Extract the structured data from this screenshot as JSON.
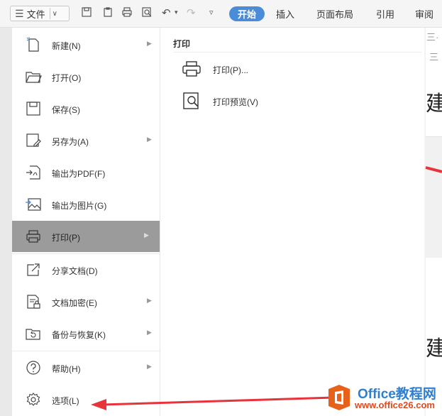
{
  "toolbar": {
    "file_label": "文件",
    "tabs": [
      {
        "label": "开始",
        "active": true
      },
      {
        "label": "插入"
      },
      {
        "label": "页面布局"
      },
      {
        "label": "引用"
      },
      {
        "label": "审阅"
      }
    ],
    "quick_access_icons": [
      "save-icon",
      "clipboard-icon",
      "print-icon",
      "print-preview-icon",
      "undo-icon",
      "redo-icon",
      "customize-icon"
    ]
  },
  "file_menu": {
    "items": [
      {
        "label": "新建(N)",
        "icon": "new-doc-icon",
        "submenu": true
      },
      {
        "label": "打开(O)",
        "icon": "folder-open-icon",
        "submenu": false
      },
      {
        "label": "保存(S)",
        "icon": "save-icon",
        "submenu": false
      },
      {
        "label": "另存为(A)",
        "icon": "save-as-icon",
        "submenu": true
      },
      {
        "label": "输出为PDF(F)",
        "icon": "export-pdf-icon",
        "submenu": false
      },
      {
        "label": "输出为图片(G)",
        "icon": "export-image-icon",
        "submenu": false
      },
      {
        "label": "打印(P)",
        "icon": "print-icon",
        "submenu": true,
        "selected": true
      },
      {
        "label": "分享文档(D)",
        "icon": "share-icon",
        "submenu": false
      },
      {
        "label": "文档加密(E)",
        "icon": "encrypt-icon",
        "submenu": true
      },
      {
        "label": "备份与恢复(K)",
        "icon": "backup-icon",
        "submenu": true
      },
      {
        "label": "帮助(H)",
        "icon": "help-icon",
        "submenu": true
      },
      {
        "label": "选项(L)",
        "icon": "gear-icon",
        "submenu": false
      }
    ]
  },
  "print_submenu": {
    "title": "打印",
    "items": [
      {
        "label": "打印(P)...",
        "icon": "print-icon"
      },
      {
        "label": "打印预览(V)",
        "icon": "print-preview-icon"
      }
    ]
  },
  "document": {
    "visible_chars": [
      "建",
      "建"
    ]
  },
  "watermark": {
    "title": "Office教程网",
    "url": "www.office26.com"
  },
  "colors": {
    "accent": "#4b8cd9",
    "selected_item": "#9b9b9b",
    "annotation_arrow": "#e8333a",
    "watermark_blue": "#2f7fd1",
    "watermark_orange": "#e04a1e"
  }
}
